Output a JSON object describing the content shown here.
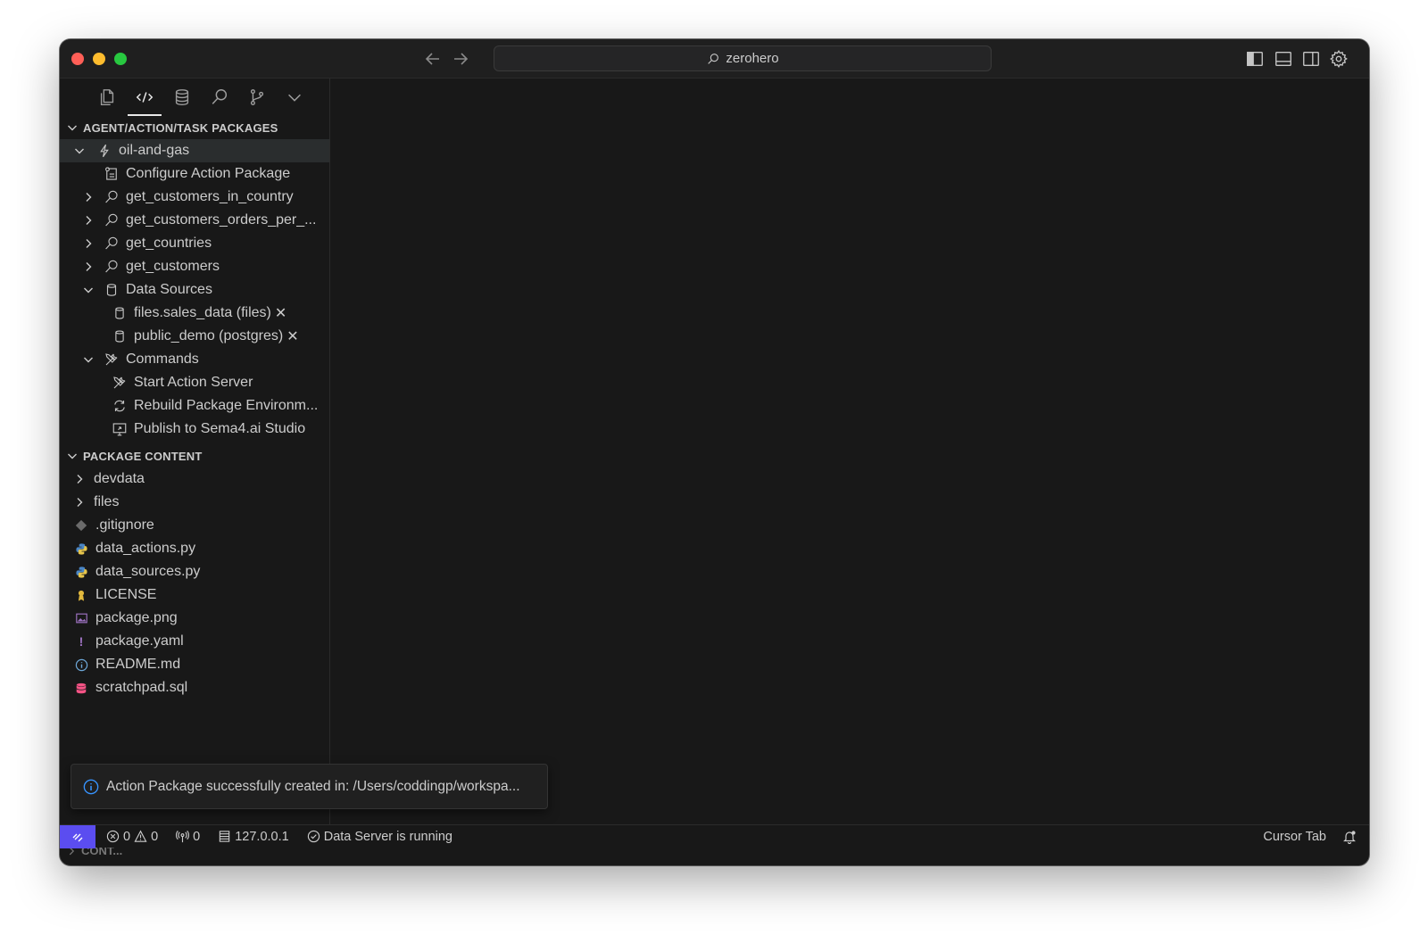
{
  "titlebar": {
    "search_text": "zerohero"
  },
  "sections": {
    "packages_title": "AGENT/ACTION/TASK PACKAGES",
    "content_title": "PACKAGE CONTENT",
    "collapsed_title": "CONT..."
  },
  "package": {
    "name": "oil-and-gas",
    "configure": "Configure Action Package",
    "actions": [
      "get_customers_in_country",
      "get_customers_orders_per_...",
      "get_countries",
      "get_customers"
    ],
    "data_sources_label": "Data Sources",
    "data_sources": [
      "files.sales_data (files)",
      "public_demo (postgres)"
    ],
    "remove_mark": "✕",
    "commands_label": "Commands",
    "commands": [
      "Start Action Server",
      "Rebuild Package Environm...",
      "Publish to Sema4.ai Studio"
    ]
  },
  "content": {
    "folders": [
      "devdata",
      "files"
    ],
    "files": [
      {
        "name": ".gitignore",
        "icon": "git-icon",
        "color": "#6b6b6b"
      },
      {
        "name": "data_actions.py",
        "icon": "python-icon",
        "color": "#5a9fd4"
      },
      {
        "name": "data_sources.py",
        "icon": "python-icon",
        "color": "#5a9fd4"
      },
      {
        "name": "LICENSE",
        "icon": "license-icon",
        "color": "#e2b93d"
      },
      {
        "name": "package.png",
        "icon": "image-icon",
        "color": "#a074c4"
      },
      {
        "name": "package.yaml",
        "icon": "yaml-icon",
        "color": "#a074c4"
      },
      {
        "name": "README.md",
        "icon": "info-icon",
        "color": "#6ea8d8"
      },
      {
        "name": "scratchpad.sql",
        "icon": "database-icon",
        "color": "#f55385"
      }
    ]
  },
  "toast": {
    "message": "Action Package successfully created in: /Users/coddingp/workspa..."
  },
  "statusbar": {
    "errors": "0",
    "warnings": "0",
    "ports": "0",
    "host": "127.0.0.1",
    "data_server": "Data Server is running",
    "cursor_tab": "Cursor Tab"
  },
  "colors": {
    "window_bg": "#181818",
    "remote_accent": "#5b4df0",
    "info_blue": "#3794ff"
  }
}
